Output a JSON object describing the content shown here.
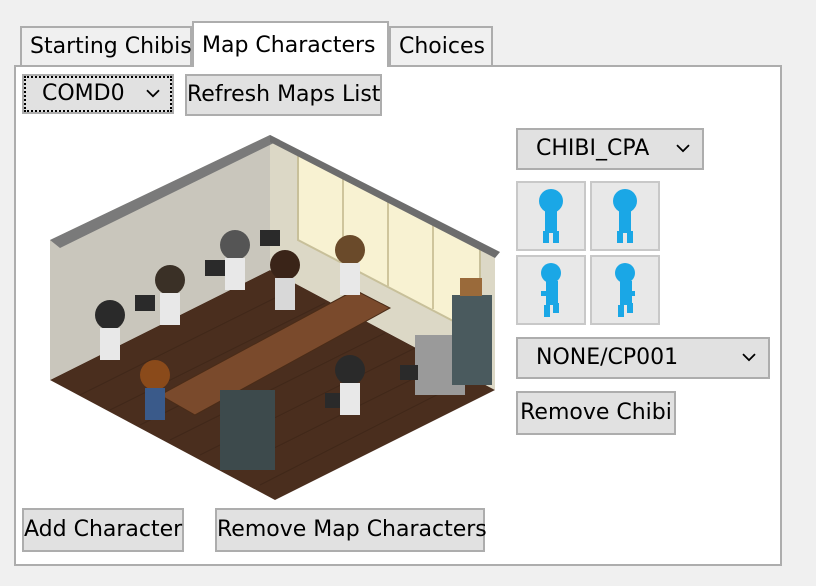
{
  "tabs": [
    {
      "label": "Starting Chibis"
    },
    {
      "label": "Map Characters"
    },
    {
      "label": "Choices"
    }
  ],
  "map_select": {
    "value": "COMD0"
  },
  "refresh_button": {
    "label": "Refresh Maps List"
  },
  "chibi_select": {
    "value": "CHIBI_CPA"
  },
  "pose_thumbnails": [
    {
      "icon": "chibi-silhouette-icon",
      "color": "#1aa7e6"
    },
    {
      "icon": "chibi-silhouette-icon",
      "color": "#1aa7e6"
    },
    {
      "icon": "chibi-silhouette-walking-icon",
      "color": "#1aa7e6"
    },
    {
      "icon": "chibi-silhouette-walking-icon",
      "color": "#1aa7e6"
    }
  ],
  "animation_select": {
    "value": "NONE/CP001"
  },
  "remove_chibi_button": {
    "label": "Remove Chibi"
  },
  "add_character_button": {
    "label": "Add Character"
  },
  "remove_map_characters_button": {
    "label": "Remove Map Characters"
  }
}
